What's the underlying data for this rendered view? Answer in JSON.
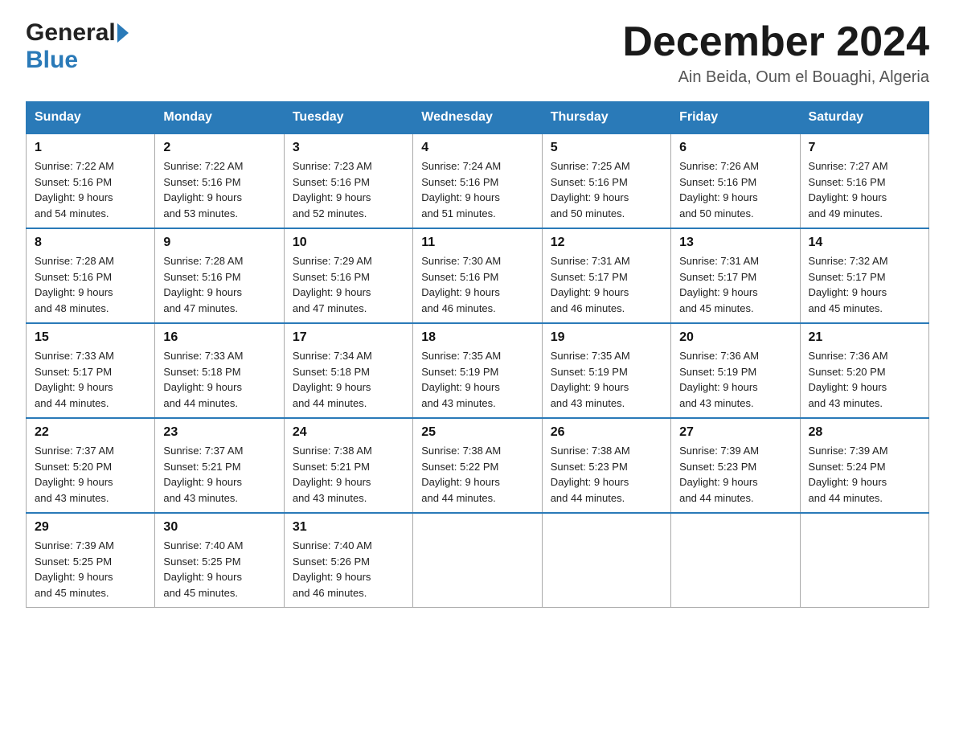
{
  "logo": {
    "general": "General",
    "blue": "Blue"
  },
  "title": "December 2024",
  "location": "Ain Beida, Oum el Bouaghi, Algeria",
  "days_of_week": [
    "Sunday",
    "Monday",
    "Tuesday",
    "Wednesday",
    "Thursday",
    "Friday",
    "Saturday"
  ],
  "weeks": [
    [
      {
        "day": "1",
        "sunrise": "7:22 AM",
        "sunset": "5:16 PM",
        "daylight": "9 hours and 54 minutes."
      },
      {
        "day": "2",
        "sunrise": "7:22 AM",
        "sunset": "5:16 PM",
        "daylight": "9 hours and 53 minutes."
      },
      {
        "day": "3",
        "sunrise": "7:23 AM",
        "sunset": "5:16 PM",
        "daylight": "9 hours and 52 minutes."
      },
      {
        "day": "4",
        "sunrise": "7:24 AM",
        "sunset": "5:16 PM",
        "daylight": "9 hours and 51 minutes."
      },
      {
        "day": "5",
        "sunrise": "7:25 AM",
        "sunset": "5:16 PM",
        "daylight": "9 hours and 50 minutes."
      },
      {
        "day": "6",
        "sunrise": "7:26 AM",
        "sunset": "5:16 PM",
        "daylight": "9 hours and 50 minutes."
      },
      {
        "day": "7",
        "sunrise": "7:27 AM",
        "sunset": "5:16 PM",
        "daylight": "9 hours and 49 minutes."
      }
    ],
    [
      {
        "day": "8",
        "sunrise": "7:28 AM",
        "sunset": "5:16 PM",
        "daylight": "9 hours and 48 minutes."
      },
      {
        "day": "9",
        "sunrise": "7:28 AM",
        "sunset": "5:16 PM",
        "daylight": "9 hours and 47 minutes."
      },
      {
        "day": "10",
        "sunrise": "7:29 AM",
        "sunset": "5:16 PM",
        "daylight": "9 hours and 47 minutes."
      },
      {
        "day": "11",
        "sunrise": "7:30 AM",
        "sunset": "5:16 PM",
        "daylight": "9 hours and 46 minutes."
      },
      {
        "day": "12",
        "sunrise": "7:31 AM",
        "sunset": "5:17 PM",
        "daylight": "9 hours and 46 minutes."
      },
      {
        "day": "13",
        "sunrise": "7:31 AM",
        "sunset": "5:17 PM",
        "daylight": "9 hours and 45 minutes."
      },
      {
        "day": "14",
        "sunrise": "7:32 AM",
        "sunset": "5:17 PM",
        "daylight": "9 hours and 45 minutes."
      }
    ],
    [
      {
        "day": "15",
        "sunrise": "7:33 AM",
        "sunset": "5:17 PM",
        "daylight": "9 hours and 44 minutes."
      },
      {
        "day": "16",
        "sunrise": "7:33 AM",
        "sunset": "5:18 PM",
        "daylight": "9 hours and 44 minutes."
      },
      {
        "day": "17",
        "sunrise": "7:34 AM",
        "sunset": "5:18 PM",
        "daylight": "9 hours and 44 minutes."
      },
      {
        "day": "18",
        "sunrise": "7:35 AM",
        "sunset": "5:19 PM",
        "daylight": "9 hours and 43 minutes."
      },
      {
        "day": "19",
        "sunrise": "7:35 AM",
        "sunset": "5:19 PM",
        "daylight": "9 hours and 43 minutes."
      },
      {
        "day": "20",
        "sunrise": "7:36 AM",
        "sunset": "5:19 PM",
        "daylight": "9 hours and 43 minutes."
      },
      {
        "day": "21",
        "sunrise": "7:36 AM",
        "sunset": "5:20 PM",
        "daylight": "9 hours and 43 minutes."
      }
    ],
    [
      {
        "day": "22",
        "sunrise": "7:37 AM",
        "sunset": "5:20 PM",
        "daylight": "9 hours and 43 minutes."
      },
      {
        "day": "23",
        "sunrise": "7:37 AM",
        "sunset": "5:21 PM",
        "daylight": "9 hours and 43 minutes."
      },
      {
        "day": "24",
        "sunrise": "7:38 AM",
        "sunset": "5:21 PM",
        "daylight": "9 hours and 43 minutes."
      },
      {
        "day": "25",
        "sunrise": "7:38 AM",
        "sunset": "5:22 PM",
        "daylight": "9 hours and 44 minutes."
      },
      {
        "day": "26",
        "sunrise": "7:38 AM",
        "sunset": "5:23 PM",
        "daylight": "9 hours and 44 minutes."
      },
      {
        "day": "27",
        "sunrise": "7:39 AM",
        "sunset": "5:23 PM",
        "daylight": "9 hours and 44 minutes."
      },
      {
        "day": "28",
        "sunrise": "7:39 AM",
        "sunset": "5:24 PM",
        "daylight": "9 hours and 44 minutes."
      }
    ],
    [
      {
        "day": "29",
        "sunrise": "7:39 AM",
        "sunset": "5:25 PM",
        "daylight": "9 hours and 45 minutes."
      },
      {
        "day": "30",
        "sunrise": "7:40 AM",
        "sunset": "5:25 PM",
        "daylight": "9 hours and 45 minutes."
      },
      {
        "day": "31",
        "sunrise": "7:40 AM",
        "sunset": "5:26 PM",
        "daylight": "9 hours and 46 minutes."
      },
      null,
      null,
      null,
      null
    ]
  ],
  "labels": {
    "sunrise": "Sunrise:",
    "sunset": "Sunset:",
    "daylight": "Daylight:"
  }
}
